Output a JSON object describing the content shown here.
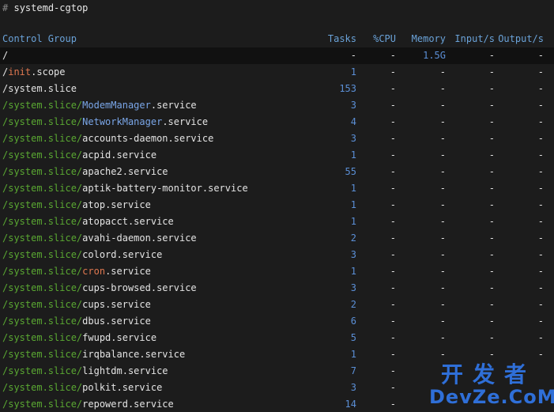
{
  "prompt": {
    "hash": "#",
    "command": "systemd-cgtop"
  },
  "headers": {
    "group": "Control Group",
    "tasks": "Tasks",
    "cpu": "%CPU",
    "memory": "Memory",
    "input": "Input/s",
    "output": "Output/s"
  },
  "rows": [
    {
      "prefix": "",
      "name": "/",
      "name_style": "base",
      "tasks": "-",
      "cpu": "-",
      "memory": "1.5G",
      "input": "-",
      "output": "-"
    },
    {
      "prefix": "",
      "name": "/init.scope",
      "name_style": "init",
      "tasks": "1",
      "cpu": "-",
      "memory": "-",
      "input": "-",
      "output": "-"
    },
    {
      "prefix": "",
      "name": "/system.slice",
      "name_style": "base",
      "tasks": "153",
      "cpu": "-",
      "memory": "-",
      "input": "-",
      "output": "-"
    },
    {
      "prefix": "/system.slice/",
      "unit": "ModemManager",
      "suffix": ".service",
      "unit_style": "blue",
      "tasks": "3",
      "cpu": "-",
      "memory": "-",
      "input": "-",
      "output": "-"
    },
    {
      "prefix": "/system.slice/",
      "unit": "NetworkManager",
      "suffix": ".service",
      "unit_style": "blue",
      "tasks": "4",
      "cpu": "-",
      "memory": "-",
      "input": "-",
      "output": "-"
    },
    {
      "prefix": "/system.slice/",
      "unit": "accounts-daemon",
      "suffix": ".service",
      "unit_style": "base",
      "tasks": "3",
      "cpu": "-",
      "memory": "-",
      "input": "-",
      "output": "-"
    },
    {
      "prefix": "/system.slice/",
      "unit": "acpid",
      "suffix": ".service",
      "unit_style": "base",
      "tasks": "1",
      "cpu": "-",
      "memory": "-",
      "input": "-",
      "output": "-"
    },
    {
      "prefix": "/system.slice/",
      "unit": "apache2",
      "suffix": ".service",
      "unit_style": "base",
      "tasks": "55",
      "cpu": "-",
      "memory": "-",
      "input": "-",
      "output": "-"
    },
    {
      "prefix": "/system.slice/",
      "unit": "aptik-battery-monitor",
      "suffix": ".service",
      "unit_style": "base",
      "tasks": "1",
      "cpu": "-",
      "memory": "-",
      "input": "-",
      "output": "-"
    },
    {
      "prefix": "/system.slice/",
      "unit": "atop",
      "suffix": ".service",
      "unit_style": "base",
      "tasks": "1",
      "cpu": "-",
      "memory": "-",
      "input": "-",
      "output": "-"
    },
    {
      "prefix": "/system.slice/",
      "unit": "atopacct",
      "suffix": ".service",
      "unit_style": "base",
      "tasks": "1",
      "cpu": "-",
      "memory": "-",
      "input": "-",
      "output": "-"
    },
    {
      "prefix": "/system.slice/",
      "unit": "avahi-daemon",
      "suffix": ".service",
      "unit_style": "base",
      "tasks": "2",
      "cpu": "-",
      "memory": "-",
      "input": "-",
      "output": "-"
    },
    {
      "prefix": "/system.slice/",
      "unit": "colord",
      "suffix": ".service",
      "unit_style": "base",
      "tasks": "3",
      "cpu": "-",
      "memory": "-",
      "input": "-",
      "output": "-"
    },
    {
      "prefix": "/system.slice/",
      "unit": "cron",
      "suffix": ".service",
      "unit_style": "orange",
      "tasks": "1",
      "cpu": "-",
      "memory": "-",
      "input": "-",
      "output": "-"
    },
    {
      "prefix": "/system.slice/",
      "unit": "cups-browsed",
      "suffix": ".service",
      "unit_style": "base",
      "tasks": "3",
      "cpu": "-",
      "memory": "-",
      "input": "-",
      "output": "-"
    },
    {
      "prefix": "/system.slice/",
      "unit": "cups",
      "suffix": ".service",
      "unit_style": "base",
      "tasks": "2",
      "cpu": "-",
      "memory": "-",
      "input": "-",
      "output": "-"
    },
    {
      "prefix": "/system.slice/",
      "unit": "dbus",
      "suffix": ".service",
      "unit_style": "base",
      "tasks": "6",
      "cpu": "-",
      "memory": "-",
      "input": "-",
      "output": "-"
    },
    {
      "prefix": "/system.slice/",
      "unit": "fwupd",
      "suffix": ".service",
      "unit_style": "base",
      "tasks": "5",
      "cpu": "-",
      "memory": "-",
      "input": "-",
      "output": "-"
    },
    {
      "prefix": "/system.slice/",
      "unit": "irqbalance",
      "suffix": ".service",
      "unit_style": "base",
      "tasks": "1",
      "cpu": "-",
      "memory": "-",
      "input": "-",
      "output": "-"
    },
    {
      "prefix": "/system.slice/",
      "unit": "lightdm",
      "suffix": ".service",
      "unit_style": "base",
      "tasks": "7",
      "cpu": "-",
      "memory": "",
      "input": "",
      "output": ""
    },
    {
      "prefix": "/system.slice/",
      "unit": "polkit",
      "suffix": ".service",
      "unit_style": "base",
      "tasks": "3",
      "cpu": "-",
      "memory": "",
      "input": "",
      "output": ""
    },
    {
      "prefix": "/system.slice/",
      "unit": "repowerd",
      "suffix": ".service",
      "unit_style": "base",
      "tasks": "14",
      "cpu": "-",
      "memory": "",
      "input": "",
      "output": ""
    }
  ],
  "watermark": {
    "top": "开发者",
    "bottom": "DevZe.CoM"
  },
  "colors": {
    "background": "#1c1c1c",
    "header": "#6aa2d8",
    "prefix_green": "#5aa832",
    "number_blue": "#5b8fd6",
    "unit_orange": "#e07850",
    "unit_blue": "#7aa6e8",
    "watermark_blue": "#2f6fd8"
  }
}
